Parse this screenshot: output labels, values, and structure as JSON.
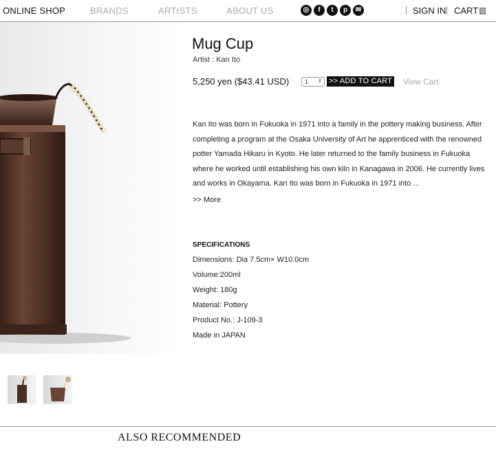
{
  "header": {
    "logo": "ONLINE SHOP",
    "nav": [
      "BRANDS",
      "ARTISTS",
      "ABOUT US"
    ],
    "social": [
      {
        "icon": "instagram-icon",
        "glyph": "◎"
      },
      {
        "icon": "facebook-icon",
        "glyph": "f"
      },
      {
        "icon": "tumblr-icon",
        "glyph": "t"
      },
      {
        "icon": "pinterest-icon",
        "glyph": "p"
      },
      {
        "icon": "mail-icon",
        "glyph": "✉"
      }
    ],
    "signin": "SIGN IN",
    "cart_label": "CART",
    "cart_count": "0"
  },
  "product": {
    "title": "Mug Cup",
    "artist": "Artist : Kan Ito",
    "price": "5,250 yen ($43.41 USD)",
    "quantity": "1",
    "add_to_cart": ">> ADD TO CART",
    "view_cart": "View Cart",
    "description": "Kan Ito was born in Fukuoka in 1971 into a family in the pottery making business. After completing a program at the Osaka University of Art he apprenticed with the renowned potter Yamada Hikaru in Kyoto. He later returned to the family business in Fukuoka where he worked until establishing his own kiln in Kanagawa in 2006. He currently lives and works in Okayama. Kan Ito was born in Fukuoka in 1971 into ...",
    "more": ">> More",
    "specs_heading": "SPECIFICATIONS",
    "specs": [
      "Dimensions: Dia 7.5cm× W10.0cm",
      "Volume:200ml",
      "Weight: 180g",
      "Material: Pottery",
      "Product No.: J-109-3",
      "Made in JAPAN"
    ]
  },
  "also_recommended": "ALSO RECOMMENDED",
  "colors": {
    "accent": "#111111",
    "muted_nav": "#aaaaaa",
    "copper": "#5a3a2c"
  }
}
